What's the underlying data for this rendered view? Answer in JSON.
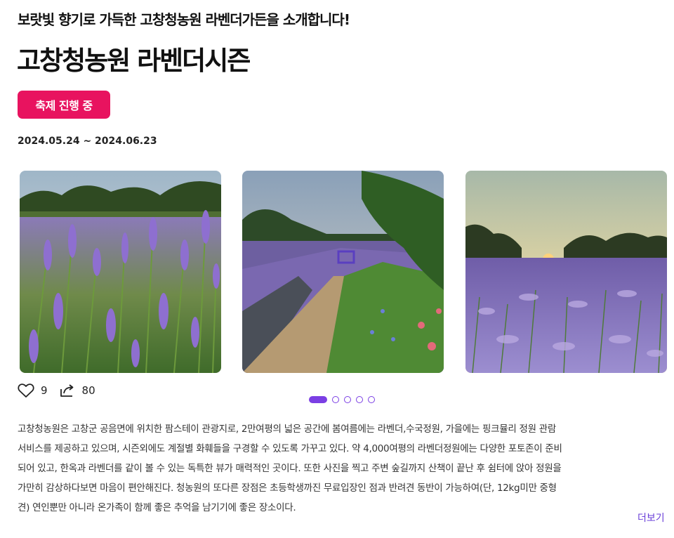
{
  "header": {
    "subtitle": "보랏빛 향기로 가득한 고창청농원 라벤더가든을 소개합니다!",
    "title": "고창청농원 라벤더시즌",
    "badge": "축제 진행 중",
    "dates": "2024.05.24 ~ 2024.06.23"
  },
  "colors": {
    "badge": "#e8135f",
    "accent": "#7b3fe4",
    "more_link": "#6a3fd8"
  },
  "carousel": {
    "slides": [
      {
        "name": "lavender-field-closeup"
      },
      {
        "name": "lavender-garden-path"
      },
      {
        "name": "lavender-field-sunset"
      }
    ],
    "pagination": {
      "total": 5,
      "active": 1
    }
  },
  "actions": {
    "like_icon": "heart-icon",
    "like_count": "9",
    "share_icon": "share-icon",
    "share_count": "80"
  },
  "description": {
    "lines": [
      "고창청농원은 고창군 공음면에 위치한 팜스테이 관광지로, 2만여평의 넓은 공간에 봄여름에는 라벤더,수국정원, 가을에는 핑크뮬리 정원 관람",
      "서비스를 제공하고 있으며, 시즌외에도 계절별 화훼들을 구경할 수 있도록 가꾸고 있다. 약 4,000여평의 라벤더정원에는 다양한 포토존이 준비",
      "되어 있고, 한옥과 라벤더를 같이 볼 수 있는 독특한 뷰가 매력적인 곳이다. 또한 사진을 찍고 주변 숲길까지 산책이 끝난 후 쉼터에 앉아 정원을",
      "가만히 감상하다보면 마음이 편안해진다. 청농원의 또다른 장점은 초등학생까진 무료입장인 점과 반려견 동반이 가능하여(단, 12kg미만 중형",
      "견) 연인뿐만 아니라 온가족이 함께 좋은 추억을 남기기에 좋은 장소이다."
    ],
    "more_label": "더보기"
  }
}
